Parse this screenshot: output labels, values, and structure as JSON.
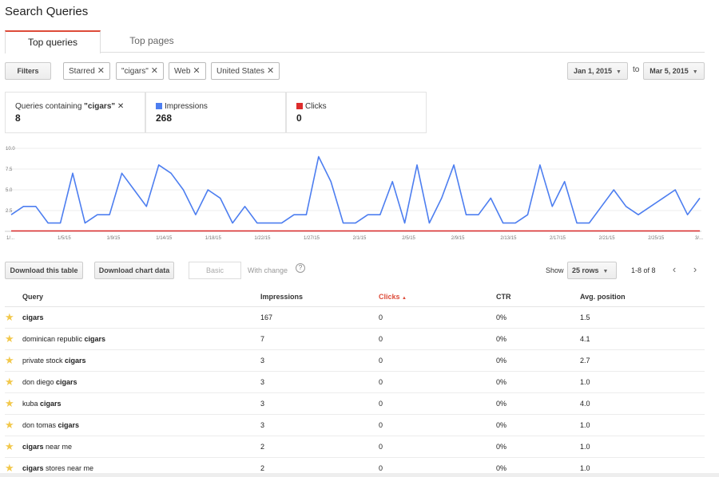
{
  "page": {
    "title": "Search Queries"
  },
  "tabs": [
    {
      "label": "Top queries",
      "active": true
    },
    {
      "label": "Top pages",
      "active": false
    }
  ],
  "filters": {
    "button_label": "Filters",
    "chips": [
      "Starred",
      "\"cigars\"",
      "Web",
      "United States"
    ],
    "date_from": "Jan 1, 2015",
    "date_sep": "to",
    "date_to": "Mar 5, 2015"
  },
  "stats": {
    "queries": {
      "label_prefix": "Queries containing ",
      "term": "\"cigars\"",
      "value": "8"
    },
    "impressions": {
      "label": "Impressions",
      "value": "268",
      "color": "#4d7ef0"
    },
    "clicks": {
      "label": "Clicks",
      "value": "0",
      "color": "#dd2c2c"
    }
  },
  "chart_data": {
    "type": "line",
    "y_ticks": [
      "10.0",
      "7.5",
      "5.0",
      "2.5"
    ],
    "ylim": [
      0,
      10
    ],
    "x_tick_labels": [
      "1/...",
      "1/5/15",
      "1/9/15",
      "1/14/15",
      "1/18/15",
      "1/22/15",
      "1/27/15",
      "2/1/15",
      "2/5/15",
      "2/9/15",
      "2/13/15",
      "2/17/15",
      "2/21/15",
      "2/25/15",
      "3/..."
    ],
    "series": [
      {
        "name": "Impressions",
        "color": "#4d7ef0",
        "values": [
          2,
          3,
          3,
          1,
          1,
          7,
          1,
          2,
          2,
          7,
          5,
          3,
          8,
          7,
          5,
          2,
          5,
          4,
          1,
          3,
          1,
          1,
          1,
          2,
          2,
          9,
          6,
          1,
          1,
          2,
          2,
          6,
          1,
          8,
          1,
          4,
          8,
          2,
          2,
          4,
          1,
          1,
          2,
          8,
          3,
          6,
          1,
          1,
          3,
          5,
          3,
          2,
          3,
          4,
          5,
          2,
          4
        ]
      },
      {
        "name": "Clicks",
        "color": "#dd2c2c",
        "values": [
          0,
          0
        ]
      }
    ]
  },
  "toolbar": {
    "download_table": "Download this table",
    "download_chart": "Download chart data",
    "basic": "Basic",
    "with_change": "With change",
    "show_label": "Show",
    "rows_option": "25 rows",
    "pager": "1-8 of 8"
  },
  "table": {
    "headers": {
      "query": "Query",
      "impressions": "Impressions",
      "clicks": "Clicks",
      "clicks_sort": "▲",
      "ctr": "CTR",
      "position": "Avg. position"
    },
    "rows": [
      {
        "pre": "",
        "bold": "cigars",
        "post": "",
        "impressions": "167",
        "clicks": "0",
        "ctr": "0%",
        "position": "1.5"
      },
      {
        "pre": "dominican republic ",
        "bold": "cigars",
        "post": "",
        "impressions": "7",
        "clicks": "0",
        "ctr": "0%",
        "position": "4.1"
      },
      {
        "pre": "private stock ",
        "bold": "cigars",
        "post": "",
        "impressions": "3",
        "clicks": "0",
        "ctr": "0%",
        "position": "2.7"
      },
      {
        "pre": "don diego ",
        "bold": "cigars",
        "post": "",
        "impressions": "3",
        "clicks": "0",
        "ctr": "0%",
        "position": "1.0"
      },
      {
        "pre": "kuba ",
        "bold": "cigars",
        "post": "",
        "impressions": "3",
        "clicks": "0",
        "ctr": "0%",
        "position": "4.0"
      },
      {
        "pre": "don tomas ",
        "bold": "cigars",
        "post": "",
        "impressions": "3",
        "clicks": "0",
        "ctr": "0%",
        "position": "1.0"
      },
      {
        "pre": "",
        "bold": "cigars",
        "post": " near me",
        "impressions": "2",
        "clicks": "0",
        "ctr": "0%",
        "position": "1.0"
      },
      {
        "pre": "",
        "bold": "cigars",
        "post": " stores near me",
        "impressions": "2",
        "clicks": "0",
        "ctr": "0%",
        "position": "1.0"
      }
    ]
  }
}
